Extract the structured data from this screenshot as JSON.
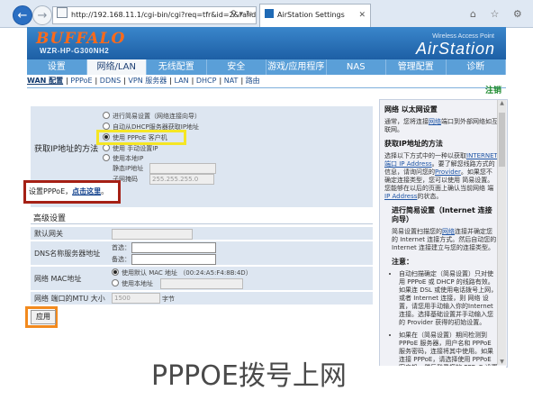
{
  "browser": {
    "url": "http://192.168.11.1/cgi-bin/cgi?req=tfr&id=2&rand=",
    "tab_title": "AirStation Settings",
    "window_icons": "⌂ ☆ ⚙"
  },
  "header": {
    "brand": "BUFFALO",
    "model": "WZR-HP-G300NH2",
    "product_type": "Wireless Access Point",
    "product_name": "AirStation"
  },
  "menu": [
    {
      "label": "设置",
      "active": false
    },
    {
      "label": "网络/LAN",
      "active": true
    },
    {
      "label": "无线配置",
      "active": false
    },
    {
      "label": "安全",
      "active": false
    },
    {
      "label": "游戏/应用程序",
      "active": false
    },
    {
      "label": "NAS",
      "active": false
    },
    {
      "label": "管理配置",
      "active": false
    },
    {
      "label": "诊断",
      "active": false
    }
  ],
  "subnav": [
    {
      "label": "WAN 配置",
      "selected": true
    },
    {
      "label": "PPPoE",
      "selected": false
    },
    {
      "label": "DDNS",
      "selected": false
    },
    {
      "label": "VPN 服务器",
      "selected": false
    },
    {
      "label": "LAN",
      "selected": false
    },
    {
      "label": "DHCP",
      "selected": false
    },
    {
      "label": "NAT",
      "selected": false
    },
    {
      "label": "路由",
      "selected": false
    }
  ],
  "apply_link": "注销",
  "ip_method": {
    "label": "获取IP地址的方法",
    "options": [
      {
        "label": "进行简易设置（网络连接向导）",
        "checked": false
      },
      {
        "label": "自动从DHCP服务器获取IP地址",
        "checked": false
      },
      {
        "label": "使用 PPPoE 客户机",
        "checked": true
      },
      {
        "label": "使用 手动设置IP",
        "checked": false
      },
      {
        "label": "使用本地IP",
        "checked": false
      }
    ],
    "static_ip_label": "静态IP地址",
    "subnet_label": "子网掩码",
    "subnet_value": "255.255.255.0"
  },
  "pppoe_hint": {
    "prefix": "设置PPPoE，",
    "link": "点击这里",
    "suffix": "。"
  },
  "advanced": {
    "title": "高级设置",
    "gateway_label": "默认网关",
    "dns_label": "DNS名称服务器地址",
    "dns_primary_label": "首选：",
    "dns_secondary_label": "备选：",
    "mac_label": "网络 MAC地址",
    "mac_default_label": "使用默认 MAC 地址 （00:24:A5:F4:8B:4D）",
    "mac_custom_label": "使用本地址",
    "mtu_label": "网络 端口的MTU 大小",
    "mtu_value": "1500",
    "mtu_unit": "字节"
  },
  "apply_button": "应用",
  "help": {
    "title": "网络 以太网设置",
    "intro_pre": "通常，您将连接",
    "intro_link": "网络",
    "intro_post": "端口到外部网络如互联网。",
    "ip_title": "获取IP地址的方法",
    "ip_text_pre": "选择以下方式中的一种以获取",
    "ip_link1": "INTERNET 端口 IP Address",
    "ip_text_mid": "。要了解您线路方式的信息，请询问您的",
    "ip_link2": "Provider",
    "ip_text_post": "。如果您不确定连接类型，您可以使用 简易设置。您能够在以后的页面上确认当前网络 端",
    "ip_link3": "IP Address",
    "ip_text_end": "的状态。",
    "easy_title": "进行简易设置（Internet 连接向导）",
    "easy_text_pre": "简易设置扫描您的",
    "easy_link": "网络",
    "easy_text_post": "连接并确定您的 Internet 连接方式。然后自动您的Internet 连接建立与您的连接类型。",
    "note_title": "注意：",
    "note1": "自动扫描确定（简易设置）只对使用 PPPoE 或 DHCP 的线路有效。如果连 DSL 或使用电话拨号上网，或者 Internet 连接，则 网络 设置，请您用手动输入你的Internet连接。选择基础设置并手动输入您的 Provider 获得的初始设置。",
    "note2": "如果在（简易设置）期间检测到 PPPoE 服务器，用户名和 PPPoE 服务密码，连接将其中使用。如果连接 PPPoE，请选择使用 PPPoE 客户机，然后登录您的 PPPoE 设置页面输入这些信息。"
  },
  "caption": "PPPOE拨号上网"
}
